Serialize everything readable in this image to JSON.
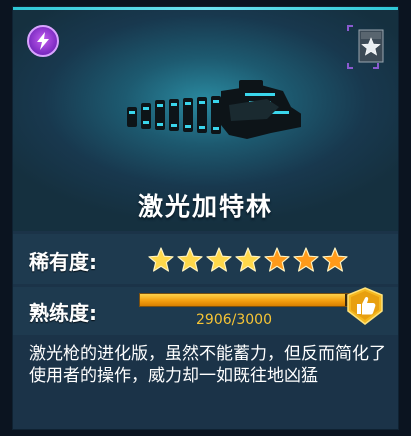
{
  "item": {
    "name": "激光加特林",
    "description": "激光枪的进化版，虽然不能蓄力，但反而简化了使用者的操作，威力却一如既往地凶猛"
  },
  "rarity": {
    "label": "稀有度:",
    "stars_total": 7,
    "stars_gold": 4,
    "stars_orange": 3
  },
  "proficiency": {
    "label": "熟练度:",
    "current": 2906,
    "max": 3000,
    "text": "2906/3000"
  },
  "icons": {
    "energy": "lightning-bolt-icon",
    "rank": "star-rank-emblem-icon",
    "proficiency_badge": "thumbs-up-icon"
  },
  "colors": {
    "accent": "#2ec7d6",
    "energy_purple": "#a040e0",
    "bar_orange": "#f5a010",
    "star_gold": "#ffd84a",
    "star_orange": "#ff9a1a"
  }
}
